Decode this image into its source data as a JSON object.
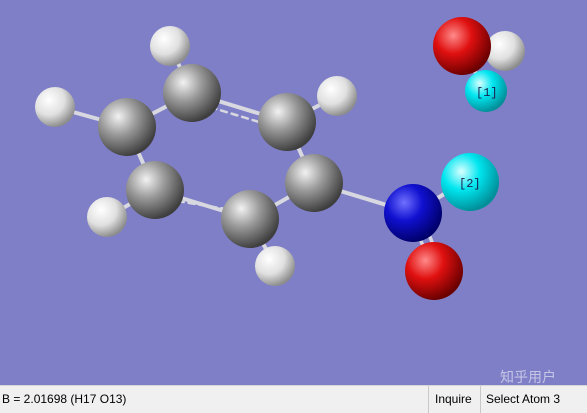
{
  "viewport": {
    "atoms": [
      {
        "element": "H",
        "name": "atom-h-1"
      },
      {
        "element": "H",
        "name": "atom-h-2"
      },
      {
        "element": "H",
        "name": "atom-h-3"
      },
      {
        "element": "H",
        "name": "atom-h-4"
      },
      {
        "element": "H",
        "name": "atom-h-5"
      },
      {
        "element": "H",
        "name": "atom-h-6"
      },
      {
        "element": "C",
        "name": "atom-c-1"
      },
      {
        "element": "C",
        "name": "atom-c-2"
      },
      {
        "element": "C",
        "name": "atom-c-3"
      },
      {
        "element": "C",
        "name": "atom-c-4"
      },
      {
        "element": "C",
        "name": "atom-c-5"
      },
      {
        "element": "C",
        "name": "atom-c-6"
      },
      {
        "element": "N",
        "name": "atom-n-1"
      },
      {
        "element": "O",
        "name": "atom-o-1"
      },
      {
        "element": "O",
        "name": "atom-o-2"
      },
      {
        "element": "H",
        "name": "atom-h-water"
      }
    ],
    "selection_labels": [
      "[1]",
      "[2]"
    ],
    "colors": {
      "background": "#7f7fc8",
      "carbon": "#909090",
      "hydrogen": "#e8e8e8",
      "nitrogen": "#1010d0",
      "oxygen": "#e01010",
      "selected": "#00e6f0",
      "bond": "#d8d8e0"
    },
    "watermark": "知乎用户"
  },
  "statusbar": {
    "bond_info": "B = 2.01698 (H17 O13)",
    "mode": "Inquire",
    "prompt": "Select Atom 3"
  }
}
